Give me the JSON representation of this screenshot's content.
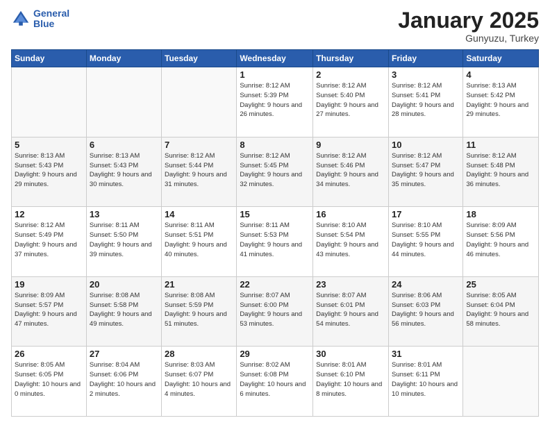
{
  "header": {
    "logo_line1": "General",
    "logo_line2": "Blue",
    "month": "January 2025",
    "location": "Gunyuzu, Turkey"
  },
  "weekdays": [
    "Sunday",
    "Monday",
    "Tuesday",
    "Wednesday",
    "Thursday",
    "Friday",
    "Saturday"
  ],
  "weeks": [
    [
      {
        "day": "",
        "info": ""
      },
      {
        "day": "",
        "info": ""
      },
      {
        "day": "",
        "info": ""
      },
      {
        "day": "1",
        "info": "Sunrise: 8:12 AM\nSunset: 5:39 PM\nDaylight: 9 hours\nand 26 minutes."
      },
      {
        "day": "2",
        "info": "Sunrise: 8:12 AM\nSunset: 5:40 PM\nDaylight: 9 hours\nand 27 minutes."
      },
      {
        "day": "3",
        "info": "Sunrise: 8:12 AM\nSunset: 5:41 PM\nDaylight: 9 hours\nand 28 minutes."
      },
      {
        "day": "4",
        "info": "Sunrise: 8:13 AM\nSunset: 5:42 PM\nDaylight: 9 hours\nand 29 minutes."
      }
    ],
    [
      {
        "day": "5",
        "info": "Sunrise: 8:13 AM\nSunset: 5:43 PM\nDaylight: 9 hours\nand 29 minutes."
      },
      {
        "day": "6",
        "info": "Sunrise: 8:13 AM\nSunset: 5:43 PM\nDaylight: 9 hours\nand 30 minutes."
      },
      {
        "day": "7",
        "info": "Sunrise: 8:12 AM\nSunset: 5:44 PM\nDaylight: 9 hours\nand 31 minutes."
      },
      {
        "day": "8",
        "info": "Sunrise: 8:12 AM\nSunset: 5:45 PM\nDaylight: 9 hours\nand 32 minutes."
      },
      {
        "day": "9",
        "info": "Sunrise: 8:12 AM\nSunset: 5:46 PM\nDaylight: 9 hours\nand 34 minutes."
      },
      {
        "day": "10",
        "info": "Sunrise: 8:12 AM\nSunset: 5:47 PM\nDaylight: 9 hours\nand 35 minutes."
      },
      {
        "day": "11",
        "info": "Sunrise: 8:12 AM\nSunset: 5:48 PM\nDaylight: 9 hours\nand 36 minutes."
      }
    ],
    [
      {
        "day": "12",
        "info": "Sunrise: 8:12 AM\nSunset: 5:49 PM\nDaylight: 9 hours\nand 37 minutes."
      },
      {
        "day": "13",
        "info": "Sunrise: 8:11 AM\nSunset: 5:50 PM\nDaylight: 9 hours\nand 39 minutes."
      },
      {
        "day": "14",
        "info": "Sunrise: 8:11 AM\nSunset: 5:51 PM\nDaylight: 9 hours\nand 40 minutes."
      },
      {
        "day": "15",
        "info": "Sunrise: 8:11 AM\nSunset: 5:53 PM\nDaylight: 9 hours\nand 41 minutes."
      },
      {
        "day": "16",
        "info": "Sunrise: 8:10 AM\nSunset: 5:54 PM\nDaylight: 9 hours\nand 43 minutes."
      },
      {
        "day": "17",
        "info": "Sunrise: 8:10 AM\nSunset: 5:55 PM\nDaylight: 9 hours\nand 44 minutes."
      },
      {
        "day": "18",
        "info": "Sunrise: 8:09 AM\nSunset: 5:56 PM\nDaylight: 9 hours\nand 46 minutes."
      }
    ],
    [
      {
        "day": "19",
        "info": "Sunrise: 8:09 AM\nSunset: 5:57 PM\nDaylight: 9 hours\nand 47 minutes."
      },
      {
        "day": "20",
        "info": "Sunrise: 8:08 AM\nSunset: 5:58 PM\nDaylight: 9 hours\nand 49 minutes."
      },
      {
        "day": "21",
        "info": "Sunrise: 8:08 AM\nSunset: 5:59 PM\nDaylight: 9 hours\nand 51 minutes."
      },
      {
        "day": "22",
        "info": "Sunrise: 8:07 AM\nSunset: 6:00 PM\nDaylight: 9 hours\nand 53 minutes."
      },
      {
        "day": "23",
        "info": "Sunrise: 8:07 AM\nSunset: 6:01 PM\nDaylight: 9 hours\nand 54 minutes."
      },
      {
        "day": "24",
        "info": "Sunrise: 8:06 AM\nSunset: 6:03 PM\nDaylight: 9 hours\nand 56 minutes."
      },
      {
        "day": "25",
        "info": "Sunrise: 8:05 AM\nSunset: 6:04 PM\nDaylight: 9 hours\nand 58 minutes."
      }
    ],
    [
      {
        "day": "26",
        "info": "Sunrise: 8:05 AM\nSunset: 6:05 PM\nDaylight: 10 hours\nand 0 minutes."
      },
      {
        "day": "27",
        "info": "Sunrise: 8:04 AM\nSunset: 6:06 PM\nDaylight: 10 hours\nand 2 minutes."
      },
      {
        "day": "28",
        "info": "Sunrise: 8:03 AM\nSunset: 6:07 PM\nDaylight: 10 hours\nand 4 minutes."
      },
      {
        "day": "29",
        "info": "Sunrise: 8:02 AM\nSunset: 6:08 PM\nDaylight: 10 hours\nand 6 minutes."
      },
      {
        "day": "30",
        "info": "Sunrise: 8:01 AM\nSunset: 6:10 PM\nDaylight: 10 hours\nand 8 minutes."
      },
      {
        "day": "31",
        "info": "Sunrise: 8:01 AM\nSunset: 6:11 PM\nDaylight: 10 hours\nand 10 minutes."
      },
      {
        "day": "",
        "info": ""
      }
    ]
  ]
}
